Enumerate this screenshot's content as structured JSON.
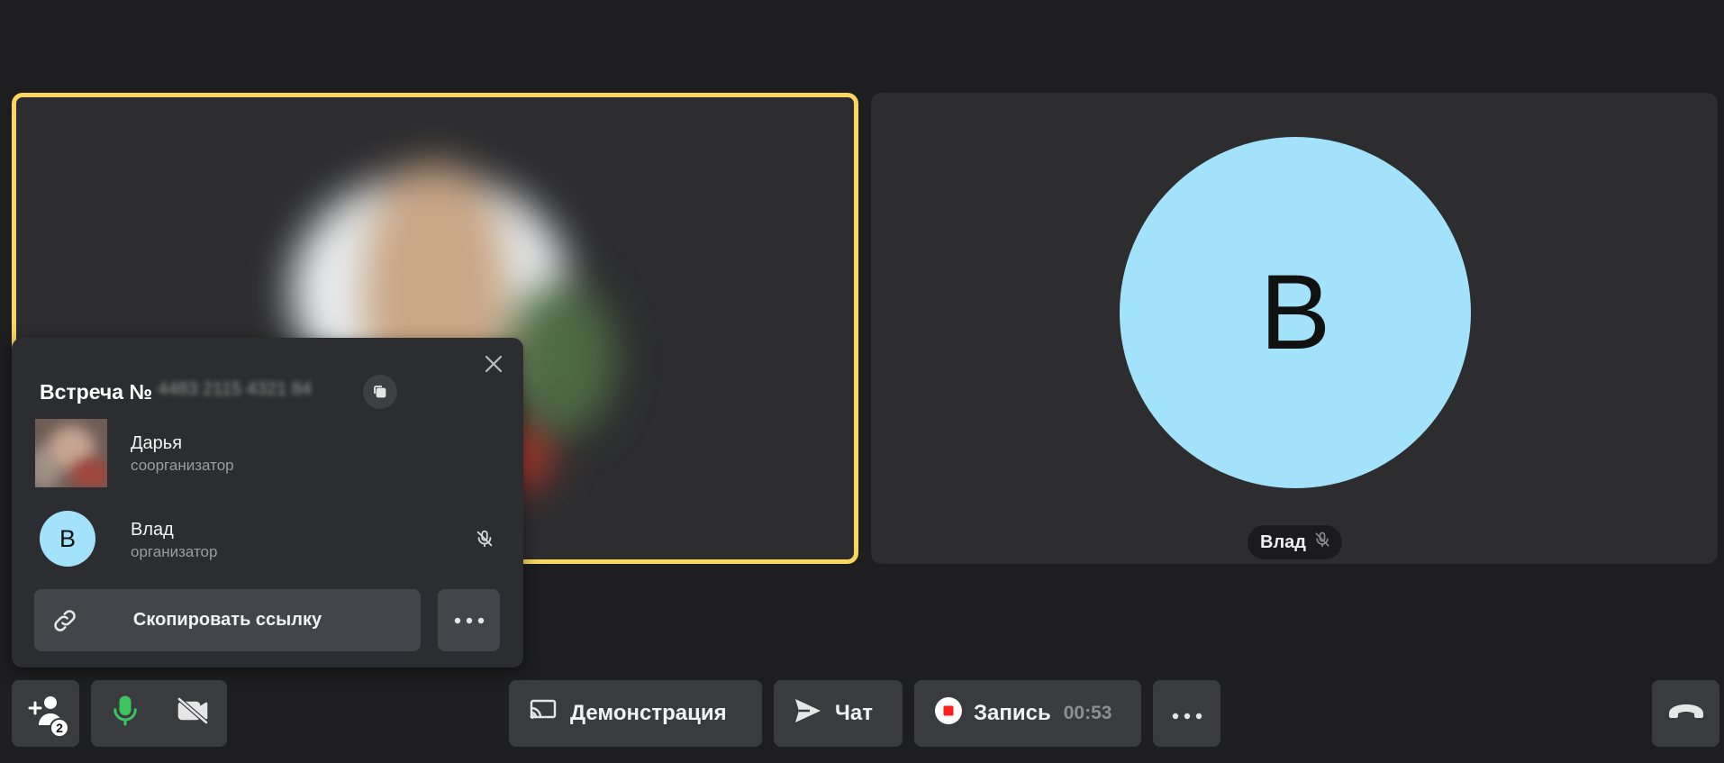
{
  "colors": {
    "background": "#1e1e20",
    "tile": "#2d2d2f",
    "active_speaker_border": "#fbd65e",
    "avatar": "#a2e3fb",
    "mic_on": "#3dc45e",
    "record_red": "#ff1f1f"
  },
  "tiles": {
    "right": {
      "avatar_letter": "В",
      "name": "Влад",
      "muted_icon": "mic-off-icon"
    }
  },
  "panel": {
    "title": "Встреча №",
    "meeting_id_masked": "4483 2115 4321 84",
    "participants": [
      {
        "name": "Дарья",
        "role": "соорганизатор"
      },
      {
        "name": "Влад",
        "role": "организатор",
        "avatar_letter": "В"
      }
    ],
    "copy_link_label": "Скопировать ссылку"
  },
  "toolbar": {
    "participants_count": "2",
    "demo_label": "Демонстрация",
    "chat_label": "Чат",
    "record_label": "Запись",
    "record_time": "00:53"
  },
  "icons": [
    "close-icon",
    "copy-icon",
    "mic-off-icon",
    "link-icon",
    "more-icon",
    "add-participant-icon",
    "mic-icon",
    "camera-off-icon",
    "screen-share-icon",
    "send-icon",
    "record-icon",
    "hangup-icon"
  ]
}
